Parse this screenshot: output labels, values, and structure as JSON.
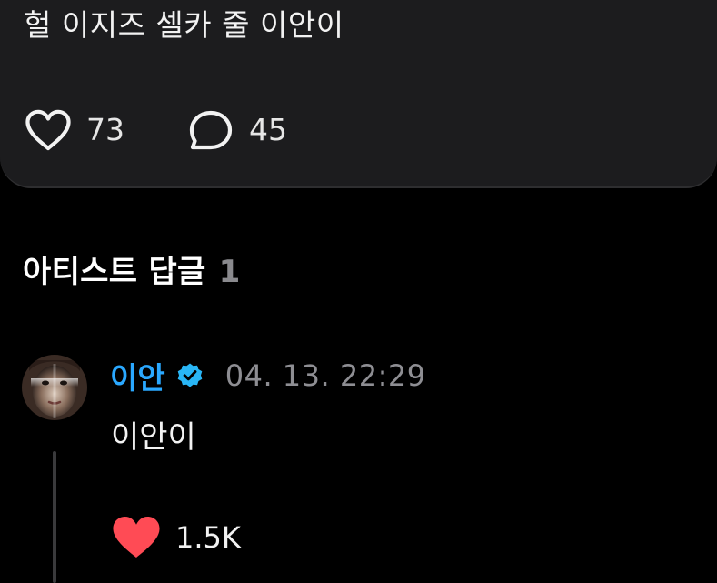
{
  "post": {
    "text": "헐 이지즈 셀카 줄 이안이",
    "likes": "73",
    "comments": "45"
  },
  "artist_replies": {
    "title": "아티스트 답글",
    "count": "1",
    "replies": [
      {
        "author": "이안",
        "verified": true,
        "time": "04. 13. 22:29",
        "text": "이안이",
        "likes": "1.5K",
        "liked": true
      }
    ]
  },
  "colors": {
    "background": "#000000",
    "card": "#1c1c1e",
    "author": "#2aa8ff",
    "verified_badge": "#29b6f6",
    "like_active": "#ff4b55",
    "muted": "#8e8e93"
  },
  "icons": {
    "like": "heart-outline-icon",
    "comment": "speech-bubble-icon",
    "verified": "verified-badge-icon",
    "reply_like": "heart-filled-icon"
  }
}
